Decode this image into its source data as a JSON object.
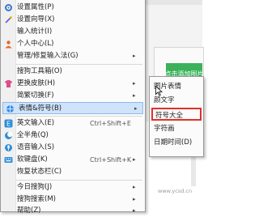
{
  "background": {
    "green_button": "点击添加图片",
    "watermark": "www.ycsd.cn"
  },
  "menu": {
    "items": [
      {
        "label": "设置属性",
        "key": "(P)",
        "icon": "gear-icon"
      },
      {
        "label": "设置向导",
        "key": "(X)",
        "icon": "wand-icon"
      },
      {
        "label": "输入统计",
        "key": "(I)",
        "icon": ""
      },
      {
        "label": "个人中心",
        "key": "(L)",
        "icon": "user-icon"
      },
      {
        "label": "管理/修复输入法",
        "key": "(G)",
        "icon": "",
        "submenu": true
      },
      {
        "label": "搜狗工具箱",
        "key": "(O)",
        "icon": ""
      },
      {
        "label": "更换皮肤",
        "key": "(H)",
        "icon": "skin-icon",
        "submenu": true
      },
      {
        "label": "简繁切换",
        "key": "(F)",
        "icon": "",
        "submenu": true
      },
      {
        "label": "表情&符号",
        "key": "(B)",
        "icon": "globe-icon",
        "submenu": true,
        "highlighted": true
      },
      {
        "label": "英文输入",
        "key": "(E)",
        "shortcut": "Ctrl+Shift+E",
        "icon": "english-icon"
      },
      {
        "label": "全半角",
        "key": "(Q)",
        "icon": "moon-icon"
      },
      {
        "label": "语音输入",
        "key": "(S)",
        "icon": "mic-icon"
      },
      {
        "label": "软键盘",
        "key": "(K)",
        "shortcut": "Ctrl+Shift+K",
        "icon": "keyboard-icon",
        "submenu": true
      },
      {
        "label": "恢复状态栏",
        "key": "(C)",
        "icon": ""
      },
      {
        "label": "今日搜狗",
        "key": "(J)",
        "icon": "",
        "submenu": true
      },
      {
        "label": "搜狗搜索",
        "key": "(M)",
        "icon": "",
        "submenu": true
      },
      {
        "label": "帮助",
        "key": "(Z)",
        "icon": "",
        "submenu": true
      }
    ],
    "arrow": "▸"
  },
  "submenu": {
    "items": [
      {
        "label": "图片表情"
      },
      {
        "label": "颜文字"
      },
      {
        "label": "符号大全"
      },
      {
        "label": "字符画"
      },
      {
        "label": "日期时间(D)"
      }
    ]
  },
  "colors": {
    "highlight": "#cfe3fb",
    "red_box": "#e0302a",
    "green": "#3bb15b"
  }
}
